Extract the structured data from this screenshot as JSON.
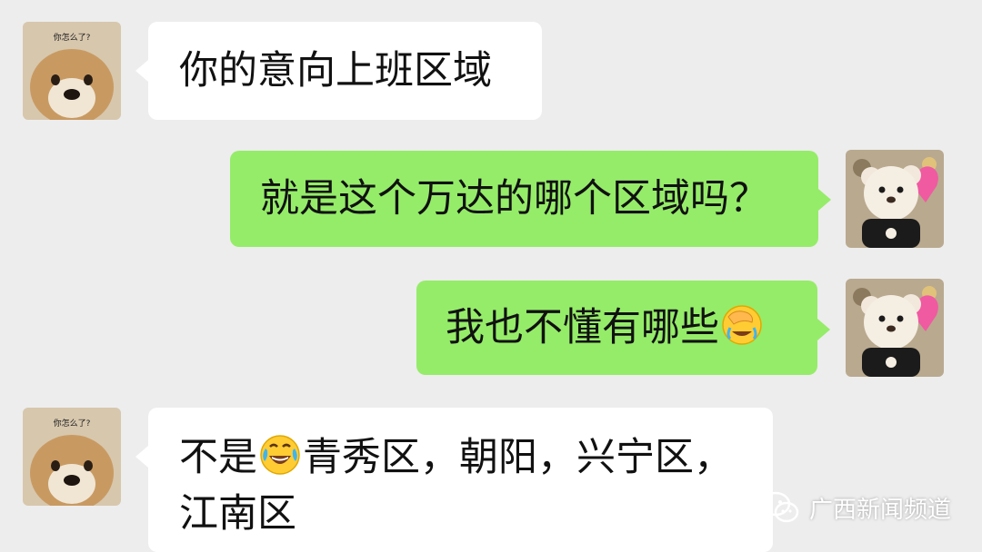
{
  "messages": [
    {
      "side": "left",
      "text": "你的意向上班区域",
      "avatar": "shiba-dog-avatar",
      "avatar_caption": "你怎么了?"
    },
    {
      "side": "right",
      "text": "就是这个万达的哪个区域吗？",
      "avatar": "teddy-bear-avatar"
    },
    {
      "side": "right",
      "text": "我也不懂有哪些",
      "emoji": "facepalm-laugh-emoji",
      "avatar": "teddy-bear-avatar"
    },
    {
      "side": "left",
      "text_part1": "不是",
      "emoji": "tears-of-joy-emoji",
      "text_part2": "青秀区，朝阳，兴宁区，",
      "text_line2": "江南区",
      "avatar": "shiba-dog-avatar",
      "avatar_caption": "你怎么了?"
    }
  ],
  "watermark": {
    "text": "广西新闻频道",
    "icon": "wechat-channel-icon"
  },
  "colors": {
    "background": "#ededed",
    "incoming_bubble": "#ffffff",
    "outgoing_bubble": "#95ec69"
  }
}
